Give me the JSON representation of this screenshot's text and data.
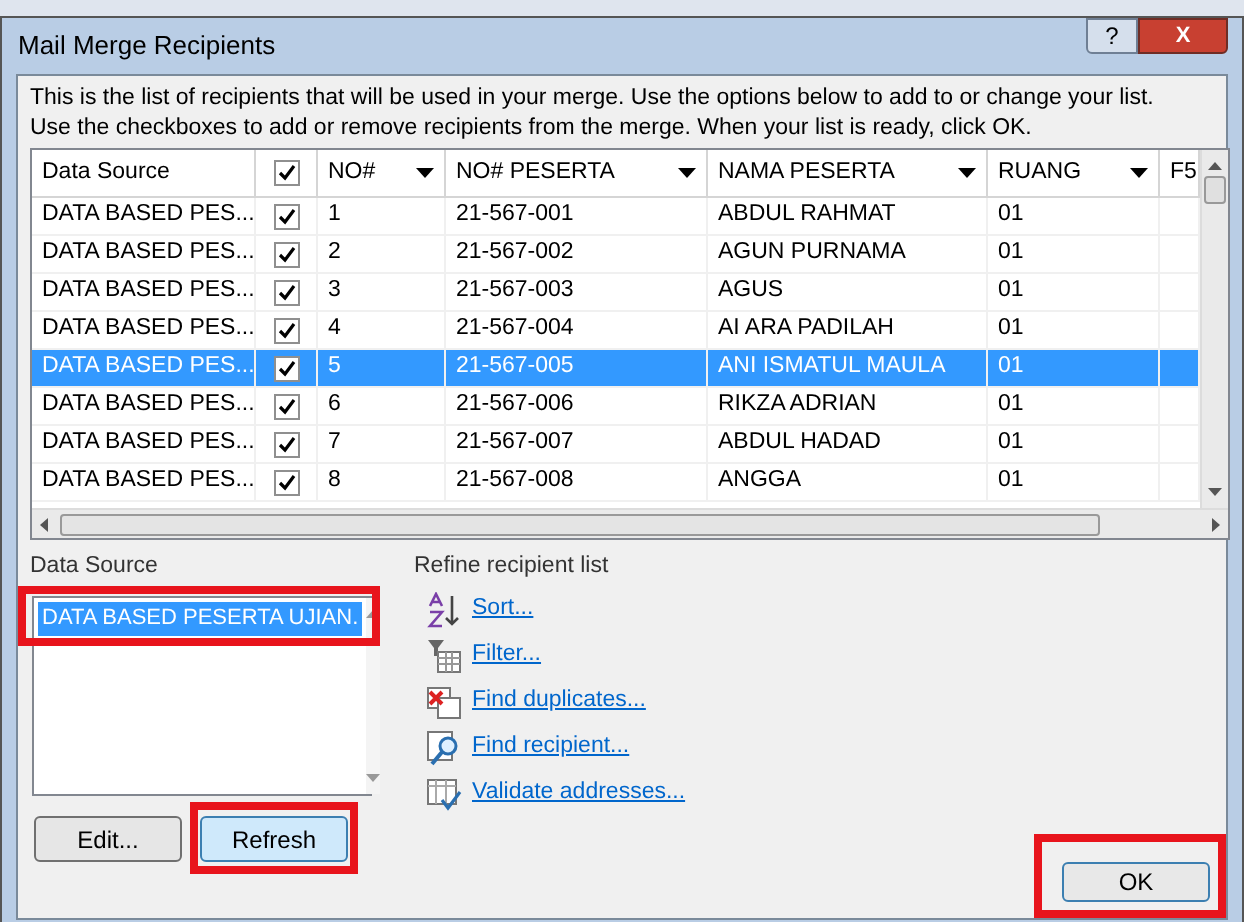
{
  "window": {
    "title": "Mail Merge Recipients",
    "help_button": "?",
    "close_button": "X"
  },
  "intro": [
    "This is the list of recipients that will be used in your merge.  Use the options below to add to or change your list.",
    "Use the checkboxes to add or remove recipients from the merge.  When your list is ready, click OK."
  ],
  "table": {
    "columns": [
      {
        "label": "Data Source",
        "kind": "text"
      },
      {
        "kind": "check",
        "checked": true
      },
      {
        "label": "NO#",
        "kind": "filter"
      },
      {
        "label": "NO# PESERTA",
        "kind": "filter"
      },
      {
        "label": "NAMA PESERTA",
        "kind": "filter"
      },
      {
        "label": "RUANG",
        "kind": "filter"
      },
      {
        "label": "F5",
        "kind": "text"
      }
    ],
    "rows": [
      {
        "source": "DATA BASED PES...",
        "checked": true,
        "no": "1",
        "peserta": "21-567-001",
        "nama": "ABDUL RAHMAT",
        "ruang": "01",
        "selected": false
      },
      {
        "source": "DATA BASED PES...",
        "checked": true,
        "no": "2",
        "peserta": "21-567-002",
        "nama": "AGUN PURNAMA",
        "ruang": "01",
        "selected": false
      },
      {
        "source": "DATA BASED PES...",
        "checked": true,
        "no": "3",
        "peserta": "21-567-003",
        "nama": "AGUS",
        "ruang": "01",
        "selected": false
      },
      {
        "source": "DATA BASED PES...",
        "checked": true,
        "no": "4",
        "peserta": "21-567-004",
        "nama": "AI ARA PADILAH",
        "ruang": "01",
        "selected": false
      },
      {
        "source": "DATA BASED PES...",
        "checked": true,
        "no": "5",
        "peserta": "21-567-005",
        "nama": "ANI ISMATUL MAULA",
        "ruang": "01",
        "selected": true
      },
      {
        "source": "DATA BASED PES...",
        "checked": true,
        "no": "6",
        "peserta": "21-567-006",
        "nama": "RIKZA ADRIAN",
        "ruang": "01",
        "selected": false
      },
      {
        "source": "DATA BASED PES...",
        "checked": true,
        "no": "7",
        "peserta": "21-567-007",
        "nama": "ABDUL HADAD",
        "ruang": "01",
        "selected": false
      },
      {
        "source": "DATA BASED PES...",
        "checked": true,
        "no": "8",
        "peserta": "21-567-008",
        "nama": "ANGGA",
        "ruang": "01",
        "selected": false
      }
    ]
  },
  "data_source": {
    "label": "Data Source",
    "items": [
      {
        "label": "DATA BASED PESERTA UJIAN.",
        "selected": true
      }
    ],
    "buttons": [
      {
        "label": "Edit...",
        "focused": false
      },
      {
        "label": "Refresh",
        "focused": true
      }
    ]
  },
  "refine": {
    "label": "Refine recipient list",
    "links": [
      {
        "label": "Sort...",
        "kind": "sort"
      },
      {
        "label": "Filter...",
        "kind": "filter"
      },
      {
        "label": "Find duplicates...",
        "kind": "duplicates"
      },
      {
        "label": "Find recipient...",
        "kind": "find"
      },
      {
        "label": "Validate addresses...",
        "kind": "validate"
      }
    ]
  },
  "ok_button": "OK"
}
